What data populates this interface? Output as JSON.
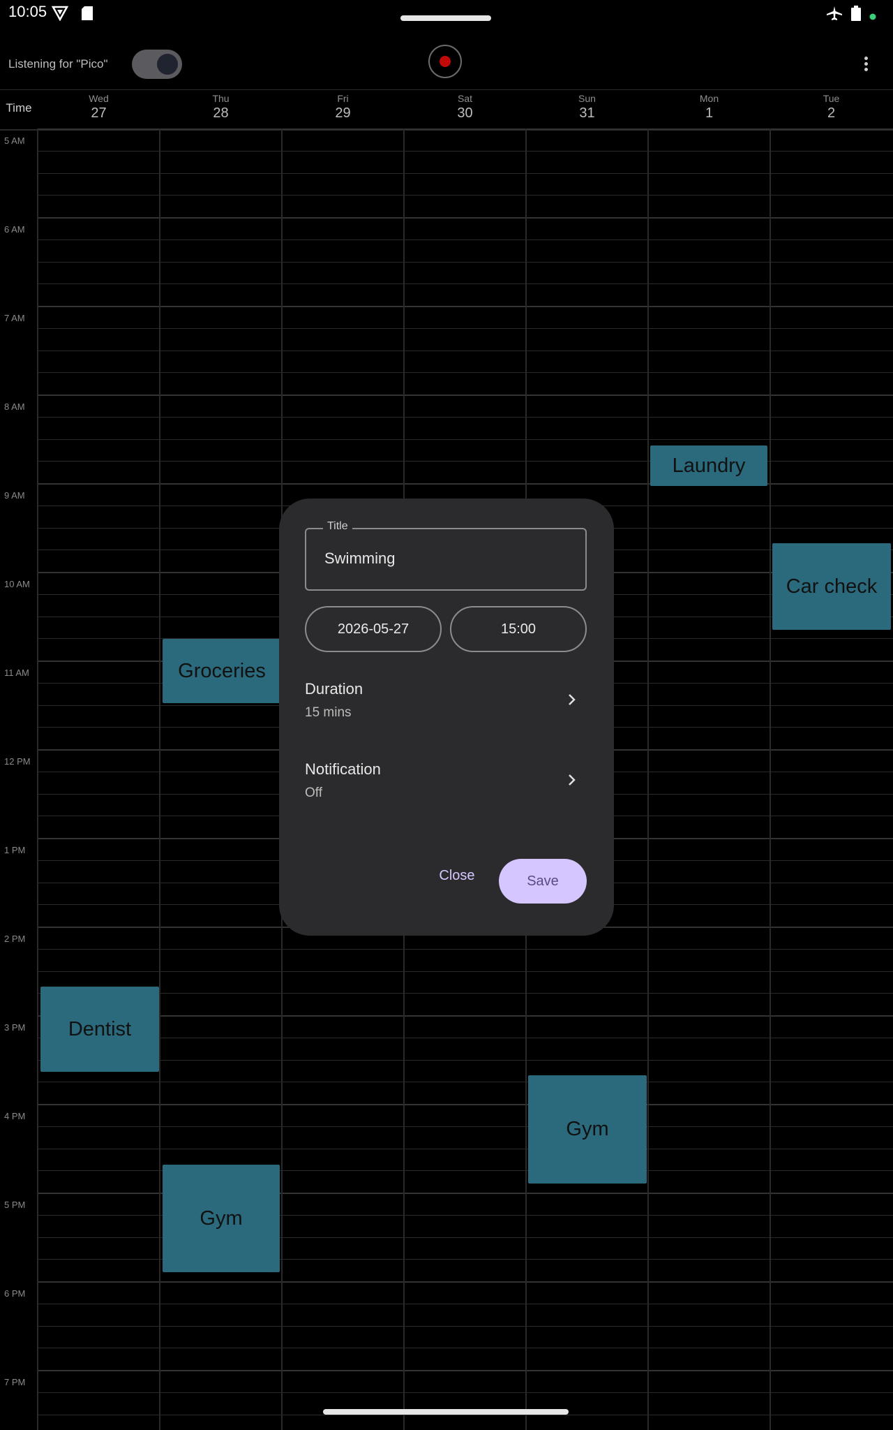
{
  "status_bar": {
    "time": "10:05",
    "icons": [
      "vpn-key-icon",
      "sd-card-icon",
      "airplane-icon",
      "battery-icon",
      "dot-icon"
    ]
  },
  "app_bar": {
    "listening_label": "Listening for \"Pico\"",
    "toggle_on": true,
    "record_color": "#c00a0a"
  },
  "calendar": {
    "time_header": "Time",
    "days": [
      {
        "name": "Wed",
        "num": "27"
      },
      {
        "name": "Thu",
        "num": "28"
      },
      {
        "name": "Fri",
        "num": "29"
      },
      {
        "name": "Sat",
        "num": "30"
      },
      {
        "name": "Sun",
        "num": "31"
      },
      {
        "name": "Mon",
        "num": "1"
      },
      {
        "name": "Tue",
        "num": "2"
      }
    ],
    "hours": [
      "5 AM",
      "6 AM",
      "7 AM",
      "8 AM",
      "9 AM",
      "10 AM",
      "11 AM",
      "12 PM",
      "1 PM",
      "2 PM",
      "3 PM",
      "4 PM",
      "5 PM",
      "6 PM",
      "7 PM"
    ],
    "events": {
      "laundry": "Laundry",
      "car_check": "Car check",
      "groceries": "Groceries",
      "dentist": "Dentist",
      "gym_sun": "Gym",
      "gym_thu": "Gym"
    },
    "event_color": "#2b6a7c"
  },
  "dialog": {
    "title_label": "Title",
    "title_value": "Swimming",
    "date": "2026-05-27",
    "time": "15:00",
    "duration_label": "Duration",
    "duration_value": "15 mins",
    "notification_label": "Notification",
    "notification_value": "Off",
    "close_label": "Close",
    "save_label": "Save",
    "accent": "#d6c6ff"
  }
}
